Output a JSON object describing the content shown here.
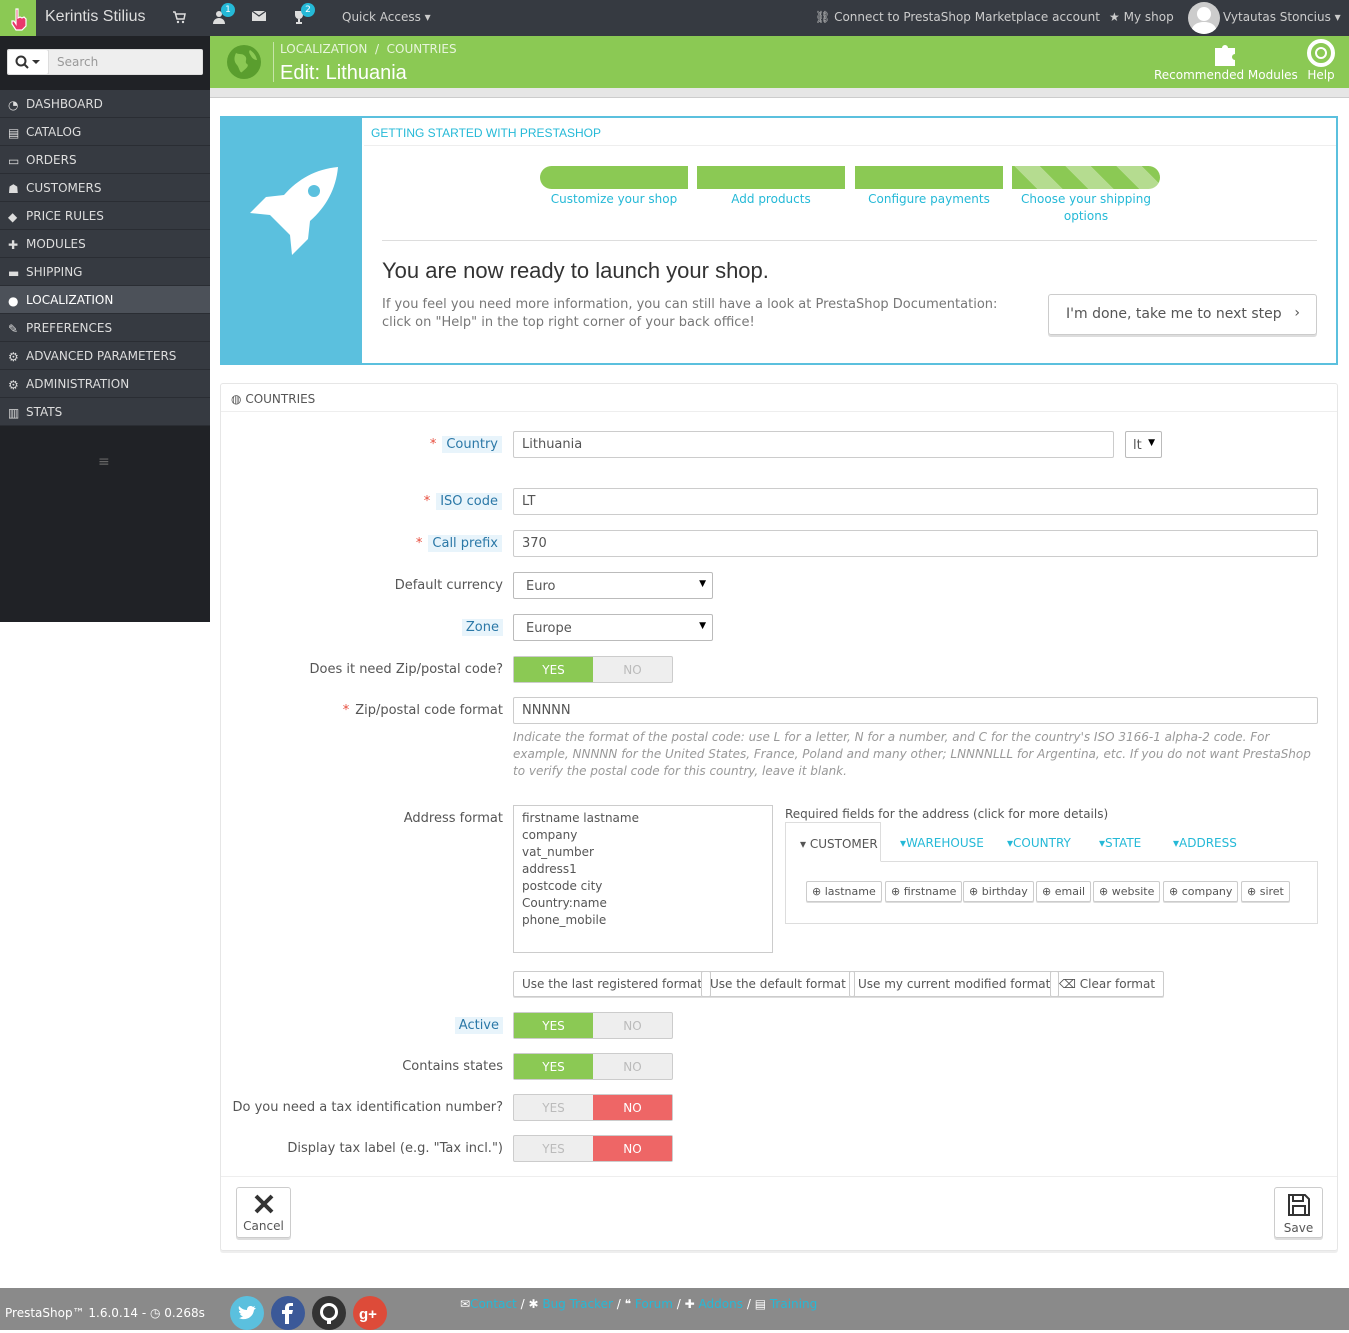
{
  "topbar": {
    "shop_name": "Kerintis Stilius",
    "customers_badge": "1",
    "trophy_badge": "2",
    "quick_access": "Quick Access",
    "connect": "Connect to PrestaShop Marketplace account",
    "my_shop": "My shop",
    "user": "Vytautas Stoncius"
  },
  "sidebar": {
    "search_placeholder": "Search",
    "items": [
      {
        "label": "DASHBOARD"
      },
      {
        "label": "CATALOG"
      },
      {
        "label": "ORDERS"
      },
      {
        "label": "CUSTOMERS"
      },
      {
        "label": "PRICE RULES"
      },
      {
        "label": "MODULES"
      },
      {
        "label": "SHIPPING"
      },
      {
        "label": "LOCALIZATION"
      },
      {
        "label": "PREFERENCES"
      },
      {
        "label": "ADVANCED PARAMETERS"
      },
      {
        "label": "ADMINISTRATION"
      },
      {
        "label": "STATS"
      }
    ]
  },
  "header": {
    "breadcrumb_1": "LOCALIZATION",
    "breadcrumb_sep": "/",
    "breadcrumb_2": "COUNTRIES",
    "title": "Edit: Lithuania",
    "recommended": "Recommended Modules",
    "help": "Help"
  },
  "getting_started": {
    "title": "GETTING STARTED WITH PRESTASHOP",
    "steps": [
      {
        "label": "Customize your shop"
      },
      {
        "label": "Add products"
      },
      {
        "label": "Configure payments"
      },
      {
        "label": "Choose your shipping options"
      }
    ],
    "ready": "You are now ready to launch your shop.",
    "text": "If you feel you need more information, you can still have a look at PrestaShop Documentation: click on \"Help\" in the top right corner of your back office!",
    "done_button": "I'm done, take me to next step"
  },
  "form": {
    "panel_title": "COUNTRIES",
    "country_label": "Country",
    "country_value": "Lithuania",
    "lang": "lt",
    "iso_label": "ISO code",
    "iso_value": "LT",
    "prefix_label": "Call prefix",
    "prefix_value": "370",
    "currency_label": "Default currency",
    "currency_value": "Euro",
    "zone_label": "Zone",
    "zone_value": "Europe",
    "zip_need_label": "Does it need Zip/postal code?",
    "zip_format_label": "Zip/postal code format",
    "zip_format_value": "NNNNN",
    "zip_help": "Indicate the format of the postal code: use L for a letter, N for a number, and C for the country's ISO 3166-1 alpha-2 code. For example, NNNNN for the United States, France, Poland and many other; LNNNNLLL for Argentina, etc. If you do not want PrestaShop to verify the postal code for this country, leave it blank.",
    "address_label": "Address format",
    "address_lines": [
      "firstname lastname",
      "company",
      "vat_number",
      "address1",
      "postcode city",
      "Country:name",
      "phone_mobile"
    ],
    "required_fields": "Required fields for the address (click for more details)",
    "tabs": [
      "CUSTOMER",
      "WAREHOUSE",
      "COUNTRY",
      "STATE",
      "ADDRESS"
    ],
    "fields": [
      "lastname",
      "firstname",
      "birthday",
      "email",
      "website",
      "company",
      "siret"
    ],
    "btn_last": "Use the last registered format",
    "btn_default": "Use the default format",
    "btn_current": "Use my current modified format",
    "btn_clear": "Clear format",
    "active_label": "Active",
    "states_label": "Contains states",
    "tax_label": "Do you need a tax identification number?",
    "taxlabel_label": "Display tax label (e.g. \"Tax incl.\")",
    "yes": "YES",
    "no": "NO",
    "cancel": "Cancel",
    "save": "Save"
  },
  "footer": {
    "version": "PrestaShop™ 1.6.0.14 -",
    "time": "0.268s",
    "contact": "Contact",
    "bug": "Bug Tracker",
    "forum": "Forum",
    "addons": "Addons",
    "training": "Training",
    "sep": "/"
  },
  "colors": {
    "accent": "#8bc954",
    "info": "#25b9d7",
    "danger": "#e66666",
    "dark": "#363a41"
  }
}
